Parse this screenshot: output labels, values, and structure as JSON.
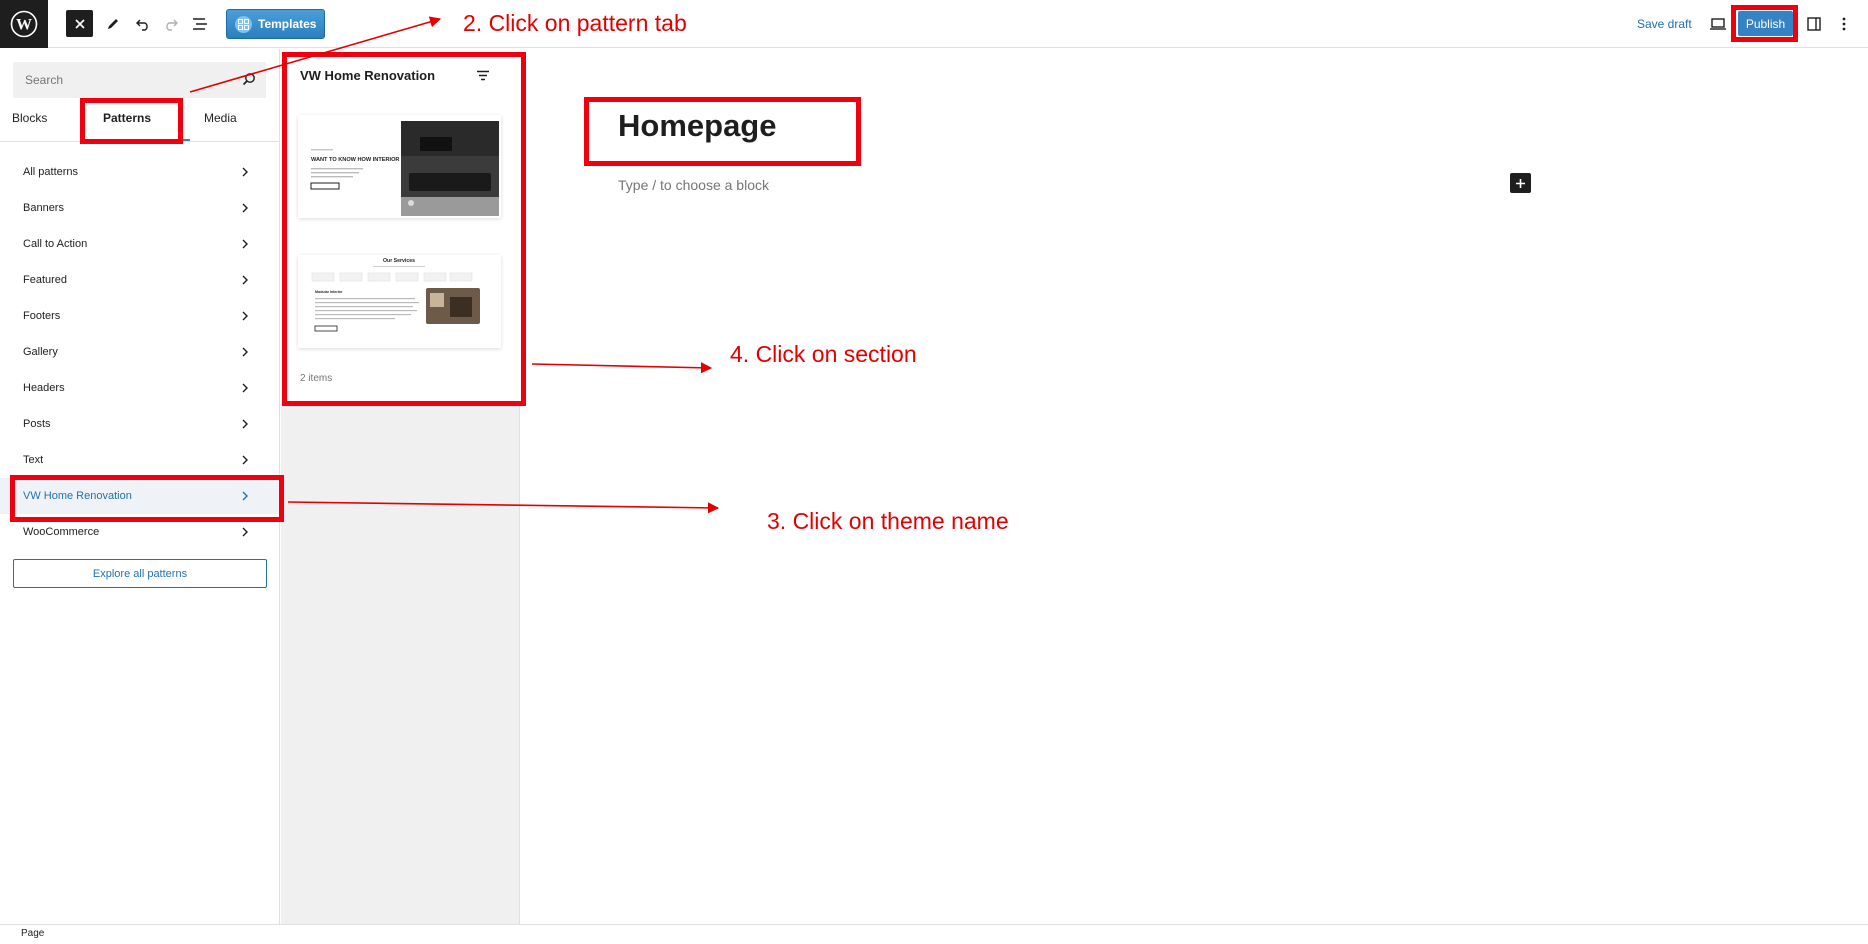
{
  "toolbar": {
    "templates_label": "Templates",
    "save_draft_label": "Save draft",
    "publish_label": "Publish"
  },
  "inserter": {
    "search_placeholder": "Search",
    "tabs": [
      {
        "label": "Blocks"
      },
      {
        "label": "Patterns"
      },
      {
        "label": "Media"
      }
    ],
    "categories": [
      {
        "label": "All patterns"
      },
      {
        "label": "Banners"
      },
      {
        "label": "Call to Action"
      },
      {
        "label": "Featured"
      },
      {
        "label": "Footers"
      },
      {
        "label": "Gallery"
      },
      {
        "label": "Headers"
      },
      {
        "label": "Posts"
      },
      {
        "label": "Text"
      },
      {
        "label": "VW Home Renovation"
      },
      {
        "label": "WooCommerce"
      }
    ],
    "explore_label": "Explore all patterns"
  },
  "pattern_panel": {
    "title": "VW Home Renovation",
    "count": "2 items",
    "card1": {
      "headline": "WANT TO KNOW HOW INTERIOR WILL COST?"
    },
    "card2": {
      "heading": "Our Services",
      "subheading": "Modular Interior"
    }
  },
  "editor": {
    "title": "Homepage",
    "placeholder": "Type / to choose a block"
  },
  "footer": {
    "breadcrumb": "Page"
  },
  "annotations": {
    "step2": "2. Click on pattern tab",
    "step3": "3. Click on theme name",
    "step4": "4. Click on section"
  },
  "colors": {
    "accent": "#3582c4",
    "link": "#2271b1",
    "annotation_red": "#f0000f"
  }
}
